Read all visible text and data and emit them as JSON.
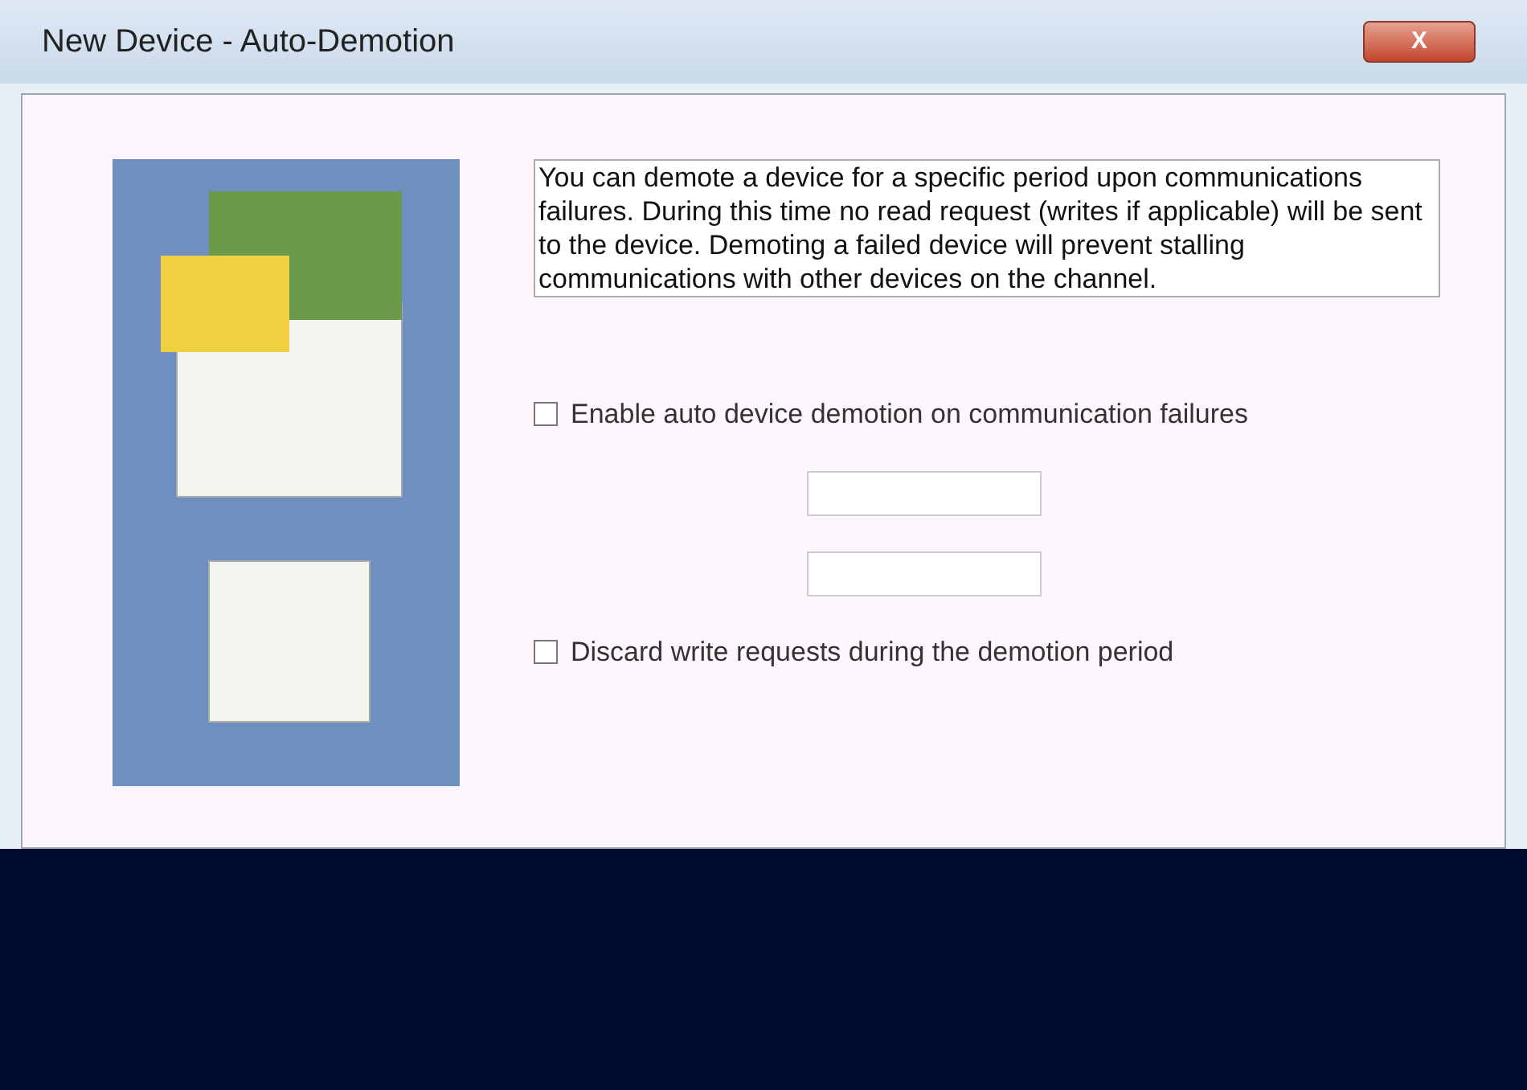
{
  "window": {
    "title": "New Device - Auto-Demotion",
    "close_glyph": "X"
  },
  "description": "You can demote a device for a specific period upon communications failures. During this time no read request (writes if applicable) will be sent to the device. Demoting a failed device will prevent stalling communications with other devices on the channel.",
  "options": [
    {
      "kind": "checkbox",
      "label": "Enable auto device demotion on communication failures",
      "checked": false
    },
    {
      "kind": "spin"
    },
    {
      "kind": "spin"
    },
    {
      "kind": "checkbox",
      "label": "Discard write requests during the demotion period",
      "checked": false
    }
  ]
}
